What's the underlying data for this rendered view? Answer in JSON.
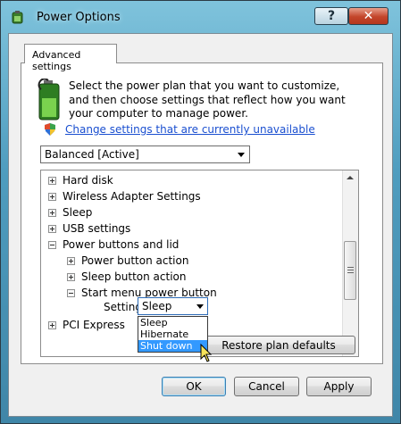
{
  "window": {
    "title": "Power Options",
    "help_label": "?",
    "close_label": "✕"
  },
  "tab": {
    "label": "Advanced settings"
  },
  "description": "Select the power plan that you want to customize, and then choose settings that reflect how you want your computer to manage power.",
  "change_settings_link": "Change settings that are currently unavailable",
  "plan_dropdown": {
    "selected": "Balanced [Active]"
  },
  "tree": {
    "items": [
      {
        "label": "Hard disk",
        "expander": "plus"
      },
      {
        "label": "Wireless Adapter Settings",
        "expander": "plus"
      },
      {
        "label": "Sleep",
        "expander": "plus"
      },
      {
        "label": "USB settings",
        "expander": "plus"
      },
      {
        "label": "Power buttons and lid",
        "expander": "minus"
      },
      {
        "label": "Power button action",
        "expander": "plus"
      },
      {
        "label": "Sleep button action",
        "expander": "plus"
      },
      {
        "label": "Start menu power button",
        "expander": "minus"
      },
      {
        "label": "PCI Express",
        "expander": "plus"
      }
    ],
    "setting_label": "Setting:",
    "setting_value": "Sleep"
  },
  "setting_dropdown": {
    "options": [
      "Sleep",
      "Hibernate",
      "Shut down"
    ],
    "highlighted": "Shut down"
  },
  "buttons": {
    "restore": "Restore plan defaults",
    "ok": "OK",
    "cancel": "Cancel",
    "apply": "Apply"
  },
  "icons": {
    "app": "power-options-icon",
    "battery": "battery-plug-icon",
    "shield": "uac-shield-icon"
  },
  "colors": {
    "link": "#1a4fd0",
    "selection": "#3399ff",
    "close_button": "#c3452a"
  }
}
